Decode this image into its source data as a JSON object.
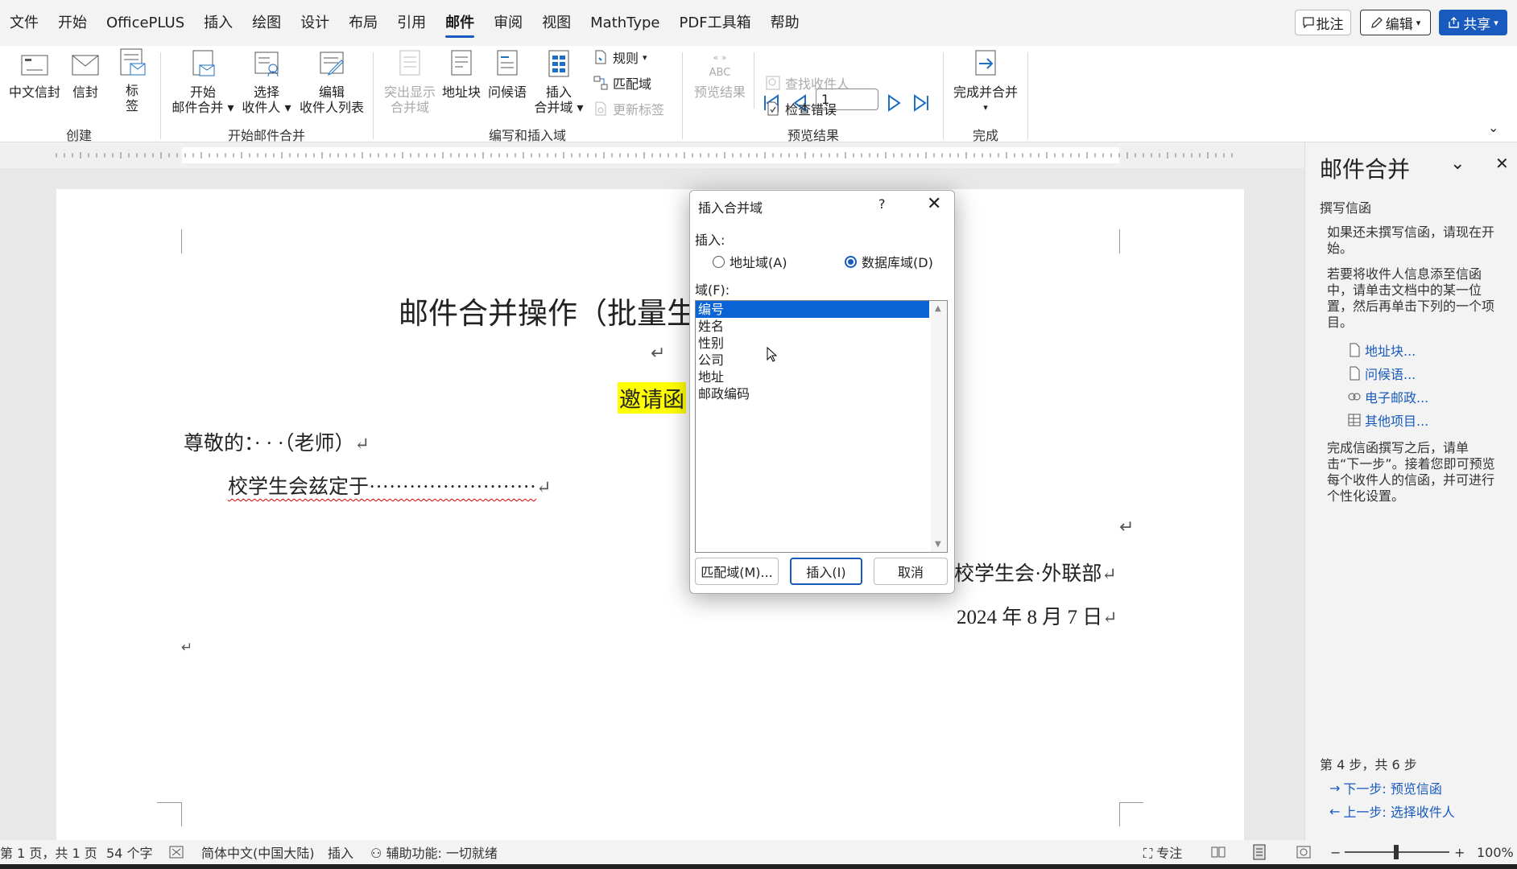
{
  "menubar": {
    "items": [
      "文件",
      "开始",
      "OfficePLUS",
      "插入",
      "绘图",
      "设计",
      "布局",
      "引用",
      "邮件",
      "审阅",
      "视图",
      "MathType",
      "PDF工具箱",
      "帮助"
    ],
    "active_index": 8,
    "comment_label": "批注",
    "edit_label": "编辑",
    "share_label": "共享"
  },
  "ribbon": {
    "create": {
      "group_label": "创建",
      "chinese_envelope": "中文信封",
      "envelope": "信封",
      "labels_1": "标",
      "labels_2": "签"
    },
    "start": {
      "group_label": "开始邮件合并",
      "start_merge_1": "开始",
      "start_merge_2": "邮件合并",
      "select_recipients_1": "选择",
      "select_recipients_2": "收件人",
      "edit_list_1": "编辑",
      "edit_list_2": "收件人列表"
    },
    "write": {
      "group_label": "编写和插入域",
      "highlight_1": "突出显示",
      "highlight_2": "合并域",
      "address_block": "地址块",
      "greeting": "问候语",
      "insert_field_1": "插入",
      "insert_field_2": "合并域",
      "rules": "规则",
      "match_fields": "匹配域",
      "update_labels": "更新标签"
    },
    "preview": {
      "group_label": "预览结果",
      "preview_1": "ABC",
      "preview_2": "预览结果",
      "record_value": "1",
      "find_recipient": "查找收件人",
      "check_errors": "检查错误"
    },
    "finish": {
      "group_label": "完成",
      "finish_merge": "完成并合并"
    }
  },
  "document": {
    "title": "邮件合并操作（批量生",
    "invitation": "邀请函",
    "salutation": "尊敬的：· · ·（老师）",
    "body": "校学生会兹定于·························",
    "signature": "校学生会·外联部",
    "date": "2024 年 8 月 7 日"
  },
  "dialog": {
    "title": "插入合并域",
    "help": "?",
    "insert_label": "插入:",
    "radio_address": "地址域(A)",
    "radio_database": "数据库域(D)",
    "fields_label": "域(F):",
    "fields": [
      "编号",
      "姓名",
      "性别",
      "公司",
      "地址",
      "邮政编码"
    ],
    "selected_field": 0,
    "match_button": "匹配域(M)...",
    "insert_button": "插入(I)",
    "cancel_button": "取消"
  },
  "pane": {
    "title": "邮件合并",
    "section": "撰写信函",
    "text1": "如果还未撰写信函，请现在开始。",
    "text2": "若要将收件人信息添至信函中，请单击文档中的某一位置，然后再单击下列的一个项目。",
    "link_address": "地址块...",
    "link_greeting": "问候语...",
    "link_postage": "电子邮政...",
    "link_more": "其他项目...",
    "text3": "完成信函撰写之后，请单击“下一步”。接着您即可预览每个收件人的信函，并可进行个性化设置。",
    "step": "第 4 步，共 6 步",
    "next": "下一步: 预览信函",
    "prev": "上一步: 选择收件人"
  },
  "statusbar": {
    "page": "第 1 页，共 1 页",
    "words": "54 个字",
    "language": "简体中文(中国大陆)",
    "mode": "插入",
    "accessibility": "辅助功能: 一切就绪",
    "focus": "专注",
    "zoom": "100%"
  },
  "colors": {
    "accent": "#185abd",
    "highlight": "#ffff00"
  }
}
